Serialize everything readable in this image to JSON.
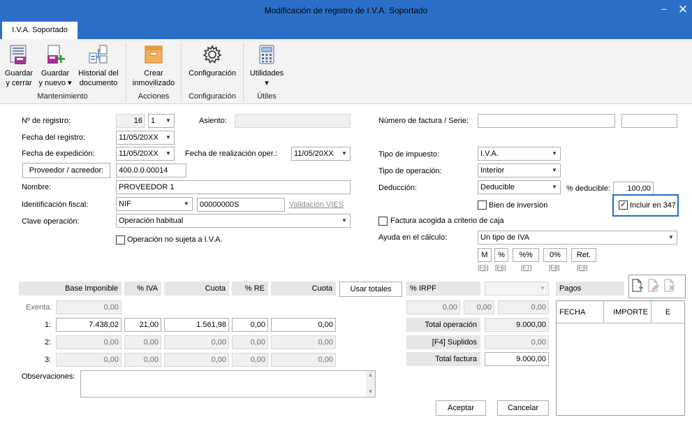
{
  "window": {
    "title": "Modificación de registro de I.V.A. Soportado",
    "minimize_glyph": "−",
    "close_glyph": "✕"
  },
  "tab": {
    "label": "I.V.A. Soportado"
  },
  "ribbon": {
    "buttons": [
      {
        "line1": "Guardar",
        "line2": "y cerrar",
        "icon": "save-close-icon"
      },
      {
        "line1": "Guardar",
        "line2": "y nuevo ▾",
        "icon": "save-new-icon"
      },
      {
        "line1": "Historial del",
        "line2": "documento",
        "icon": "history-icon"
      },
      {
        "line1": "Crear",
        "line2": "inmovilizado",
        "icon": "asset-folder-icon"
      },
      {
        "line1": "Configuración",
        "line2": "",
        "icon": "gear-icon"
      },
      {
        "line1": "Utilidades",
        "line2": "▾",
        "icon": "calculator-icon"
      }
    ],
    "groups": [
      "Mantenimiento",
      "Acciones",
      "Configuración",
      "Útiles"
    ]
  },
  "form": {
    "registro_label": "Nº de registro:",
    "registro_num": "16",
    "registro_sel": "1",
    "asiento_label": "Asiento:",
    "asiento_value": "",
    "fecha_registro_label": "Fecha del registro:",
    "fecha_registro": "11/05/20XX",
    "fecha_expedicion_label": "Fecha de expedición:",
    "fecha_expedicion": "11/05/20XX",
    "fecha_realizacion_label": "Fecha de realización oper.:",
    "fecha_realizacion": "11/05/20XX",
    "proveedor_button": "Proveedor / acreedor:",
    "proveedor_value": "400.0.0.00014",
    "nombre_label": "Nombre:",
    "nombre_value": "PROVEEDOR 1",
    "identificacion_label": "Identificación fiscal:",
    "identificacion_tipo": "NIF",
    "identificacion_num": "00000000S",
    "validacion_link": "Validación VIES",
    "clave_label": "Clave operación:",
    "clave_value": "Operación habitual",
    "no_sujeta_label": "Operación no sujeta a I.V.A.",
    "factura_label": "Número de factura / Serie:",
    "factura_num": "",
    "factura_serie": "",
    "tipo_impuesto_label": "Tipo de impuesto:",
    "tipo_impuesto": "I.V.A.",
    "tipo_operacion_label": "Tipo de operación:",
    "tipo_operacion": "Interior",
    "deduccion_label": "Deducción:",
    "deduccion": "Deducible",
    "pct_deducible_label": "% deducible:",
    "pct_deducible": "100,00",
    "bien_inversion_label": "Bien de inversión",
    "incluir_347_label": "Incluir en 347",
    "incluir_347_checked": "✓",
    "factura_caja_label": "Factura acogida a criterio de caja",
    "ayuda_label": "Ayuda en el cálculo:",
    "ayuda_value": "Un tipo de IVA",
    "calc_buttons": [
      {
        "label": "M",
        "key": "[F5]"
      },
      {
        "label": "%",
        "key": "[F6]"
      },
      {
        "label": "%%",
        "key": "[F7]"
      },
      {
        "label": "0%",
        "key": "[F8]"
      },
      {
        "label": "Ret.",
        "key": "[F9]"
      }
    ]
  },
  "grid": {
    "headers": {
      "base": "Base Imponible",
      "iva": "% IVA",
      "cuota": "Cuota",
      "re": "% RE",
      "cuota_re": "Cuota"
    },
    "usar_totales": "Usar totales",
    "exenta_label": "Exenta:",
    "exenta_value": "0,00",
    "rows": [
      {
        "label": "1:",
        "base": "7.438,02",
        "iva": "21,00",
        "cuota": "1.561,98",
        "re": "0,00",
        "cuota_re": "0,00"
      },
      {
        "label": "2:",
        "base": "0,00",
        "iva": "0,00",
        "cuota": "0,00",
        "re": "0,00",
        "cuota_re": "0,00"
      },
      {
        "label": "3:",
        "base": "0,00",
        "iva": "0,00",
        "cuota": "0,00",
        "re": "0,00",
        "cuota_re": "0,00"
      }
    ]
  },
  "irpf": {
    "label": "% IRPF",
    "select_value": "",
    "values": [
      "0,00",
      "0,00",
      "0,00"
    ],
    "total_operacion_label": "Total operación",
    "total_operacion": "9.000,00",
    "suplidos_label": "[F4] Suplidos",
    "suplidos": "0,00",
    "total_factura_label": "Total factura",
    "total_factura": "9.000,00"
  },
  "pagos": {
    "label": "Pagos",
    "columns": [
      "FECHA",
      "IMPORTE",
      "E"
    ],
    "icons": [
      "new-document-icon",
      "edit-document-icon",
      "delete-document-icon"
    ]
  },
  "observaciones": {
    "label": "Observaciones:",
    "value": ""
  },
  "footer": {
    "aceptar": "Aceptar",
    "cancelar": "Cancelar"
  },
  "colors": {
    "titlebar": "#2c6fc9",
    "highlight_box": "#1f6fc5"
  }
}
